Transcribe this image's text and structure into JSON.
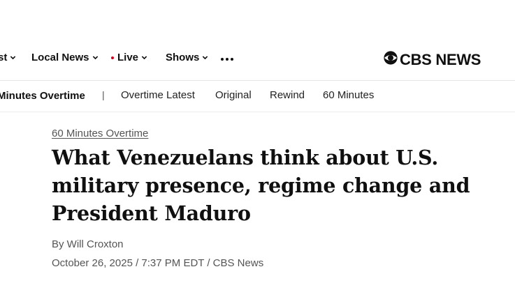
{
  "topnav": {
    "items": [
      {
        "label": "st"
      },
      {
        "label": "Local News"
      },
      {
        "label": "Live"
      },
      {
        "label": "Shows"
      }
    ]
  },
  "brand": {
    "logo_text": "CBS NEWS",
    "accent": "#d0021b"
  },
  "subnav": {
    "current": "Minutes Overtime",
    "separator": "|",
    "items": [
      {
        "label": "Overtime Latest"
      },
      {
        "label": "Original"
      },
      {
        "label": "Rewind"
      },
      {
        "label": "60 Minutes"
      }
    ]
  },
  "article": {
    "kicker": "60 Minutes Overtime",
    "headline": "What Venezuelans think about U.S. military presence, regime change and President Maduro",
    "byline": "By Will Croxton",
    "dateline": "October 26, 2025 / 7:37 PM EDT / CBS News"
  }
}
